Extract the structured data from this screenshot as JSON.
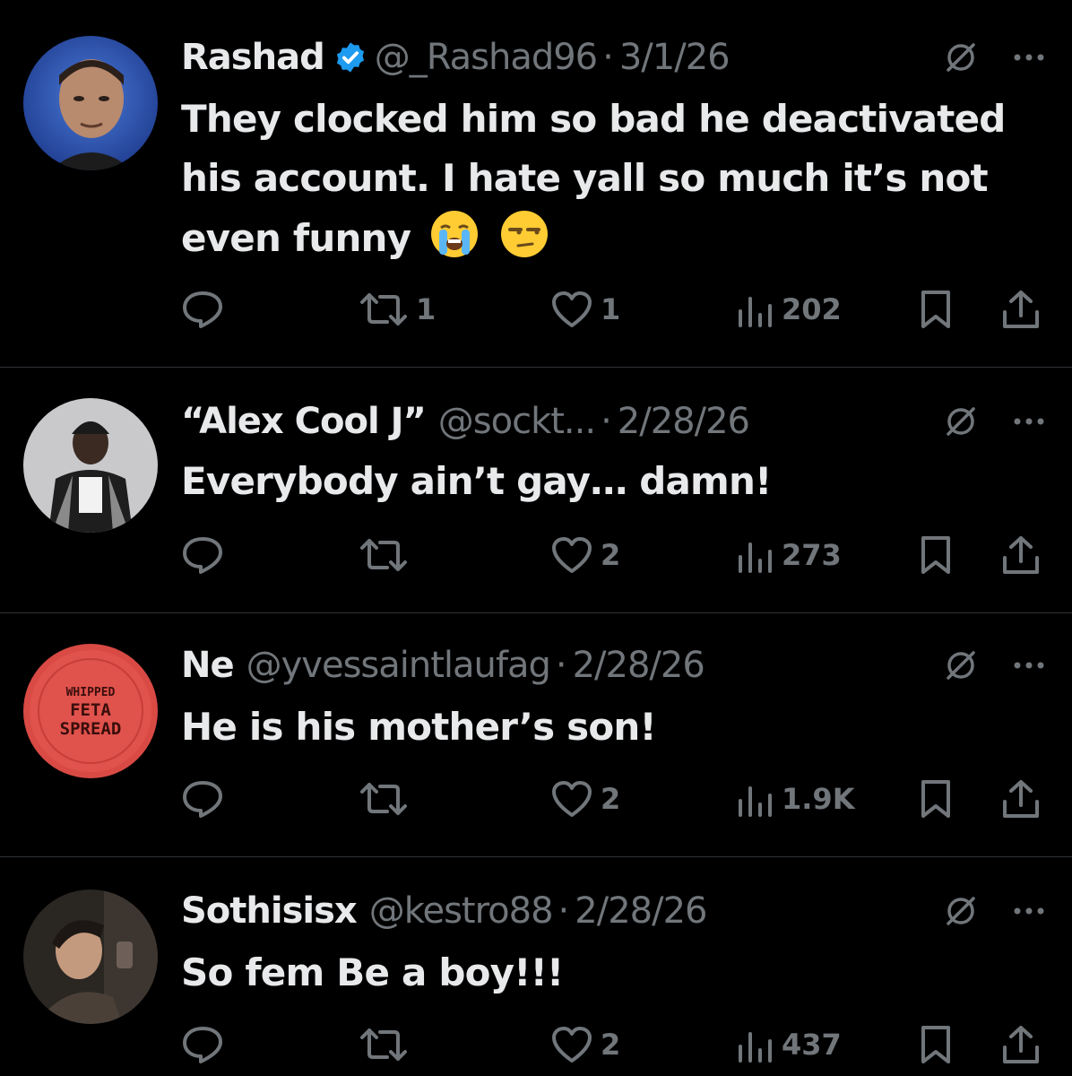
{
  "posts": [
    {
      "name": "Rashad",
      "verified": true,
      "handle": "@_Rashad96",
      "separator": "·",
      "date": "3/1/26",
      "text": "They clocked him so bad he deactivated his account. I hate yall so much it’s not even funny",
      "emojis": [
        "loudly-crying-face",
        "unamused-face"
      ],
      "replies": "",
      "reposts": "1",
      "likes": "1",
      "views": "202"
    },
    {
      "name": "“Alex Cool J”",
      "verified": false,
      "handle": "@sockt...",
      "separator": "·",
      "date": "2/28/26",
      "text": "Everybody ain’t gay… damn!",
      "replies": "",
      "reposts": "",
      "likes": "2",
      "views": "273"
    },
    {
      "name": "Ne",
      "verified": false,
      "handle": "@yvessaintlaufag",
      "separator": "·",
      "date": "2/28/26",
      "text": "He is his mother’s son!",
      "avatar_text": [
        "WHIPPED",
        "FETA",
        "SPREAD"
      ],
      "replies": "",
      "reposts": "",
      "likes": "2",
      "views": "1.9K"
    },
    {
      "name": "Sothisisx",
      "verified": false,
      "handle": "@kestro88",
      "separator": "·",
      "date": "2/28/26",
      "text": "So fem Be a boy!!!",
      "replies": "",
      "reposts": "",
      "likes": "2",
      "views": "437"
    }
  ],
  "colors": {
    "background": "#000000",
    "text_primary": "#e7e9ea",
    "text_secondary": "#71767b",
    "verified_blue": "#1d9bf0",
    "divider": "#2f3336"
  },
  "icons": [
    "verified-badge-icon",
    "grok-icon",
    "more-icon",
    "reply-icon",
    "repost-icon",
    "like-icon",
    "views-icon",
    "bookmark-icon",
    "share-icon"
  ]
}
